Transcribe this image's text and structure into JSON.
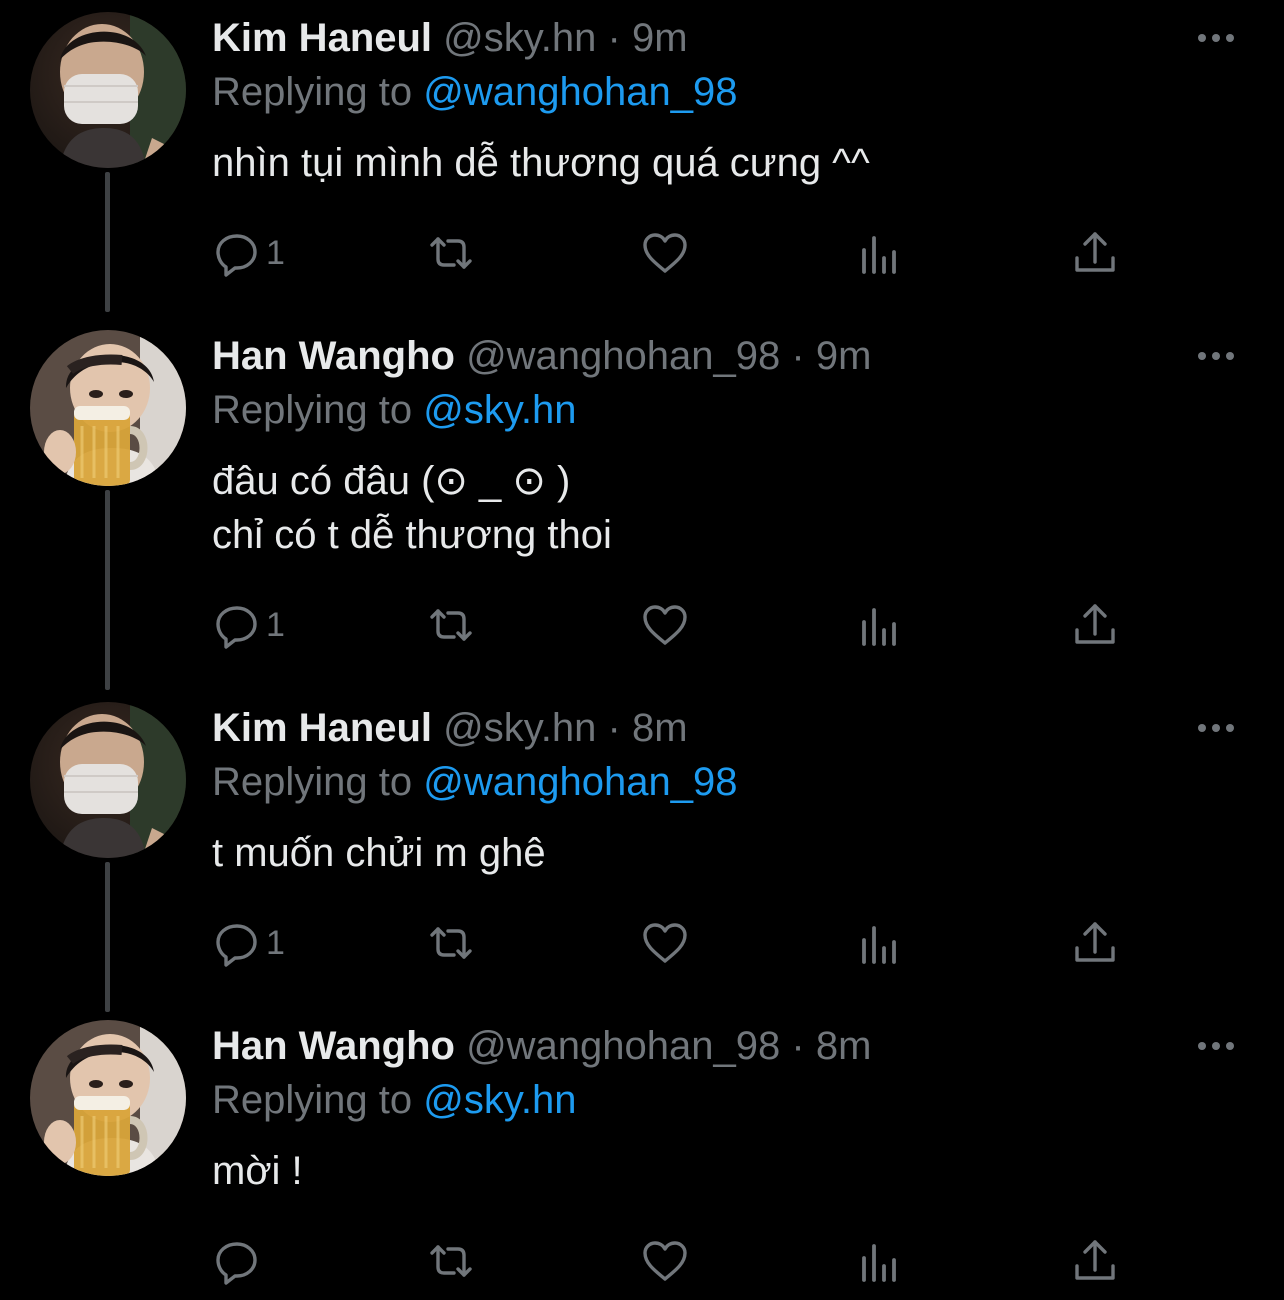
{
  "tweets": [
    {
      "name": "Kim Haneul",
      "handle": "@sky.hn",
      "dot": "·",
      "time": "9m",
      "replying_label": "Replying to",
      "replying_to": "@wanghohan_98",
      "text": "nhìn tụi mình dễ thương quá cưng ^^",
      "reply_count": "1",
      "avatar": "masked-man-avatar"
    },
    {
      "name": "Han Wangho",
      "handle": "@wanghohan_98",
      "dot": "·",
      "time": "9m",
      "replying_label": "Replying to",
      "replying_to": "@sky.hn",
      "text": "đâu có đâu (⊙ _ ⊙ )\nchỉ có t dễ thương thoi",
      "reply_count": "1",
      "avatar": "beer-mug-avatar"
    },
    {
      "name": "Kim Haneul",
      "handle": "@sky.hn",
      "dot": "·",
      "time": "8m",
      "replying_label": "Replying to",
      "replying_to": "@wanghohan_98",
      "text": "t muốn chửi m ghê",
      "reply_count": "1",
      "avatar": "masked-man-avatar"
    },
    {
      "name": "Han Wangho",
      "handle": "@wanghohan_98",
      "dot": "·",
      "time": "8m",
      "replying_label": "Replying to",
      "replying_to": "@sky.hn",
      "text": "mời !",
      "reply_count": "",
      "avatar": "beer-mug-avatar"
    }
  ],
  "colors": {
    "background": "#000000",
    "text": "#e7e9ea",
    "secondary": "#71767b",
    "mention": "#1d9bf0",
    "thread_line": "#3e4144"
  },
  "icons": [
    "reply-icon",
    "retweet-icon",
    "like-icon",
    "analytics-icon",
    "share-icon",
    "more-icon"
  ]
}
